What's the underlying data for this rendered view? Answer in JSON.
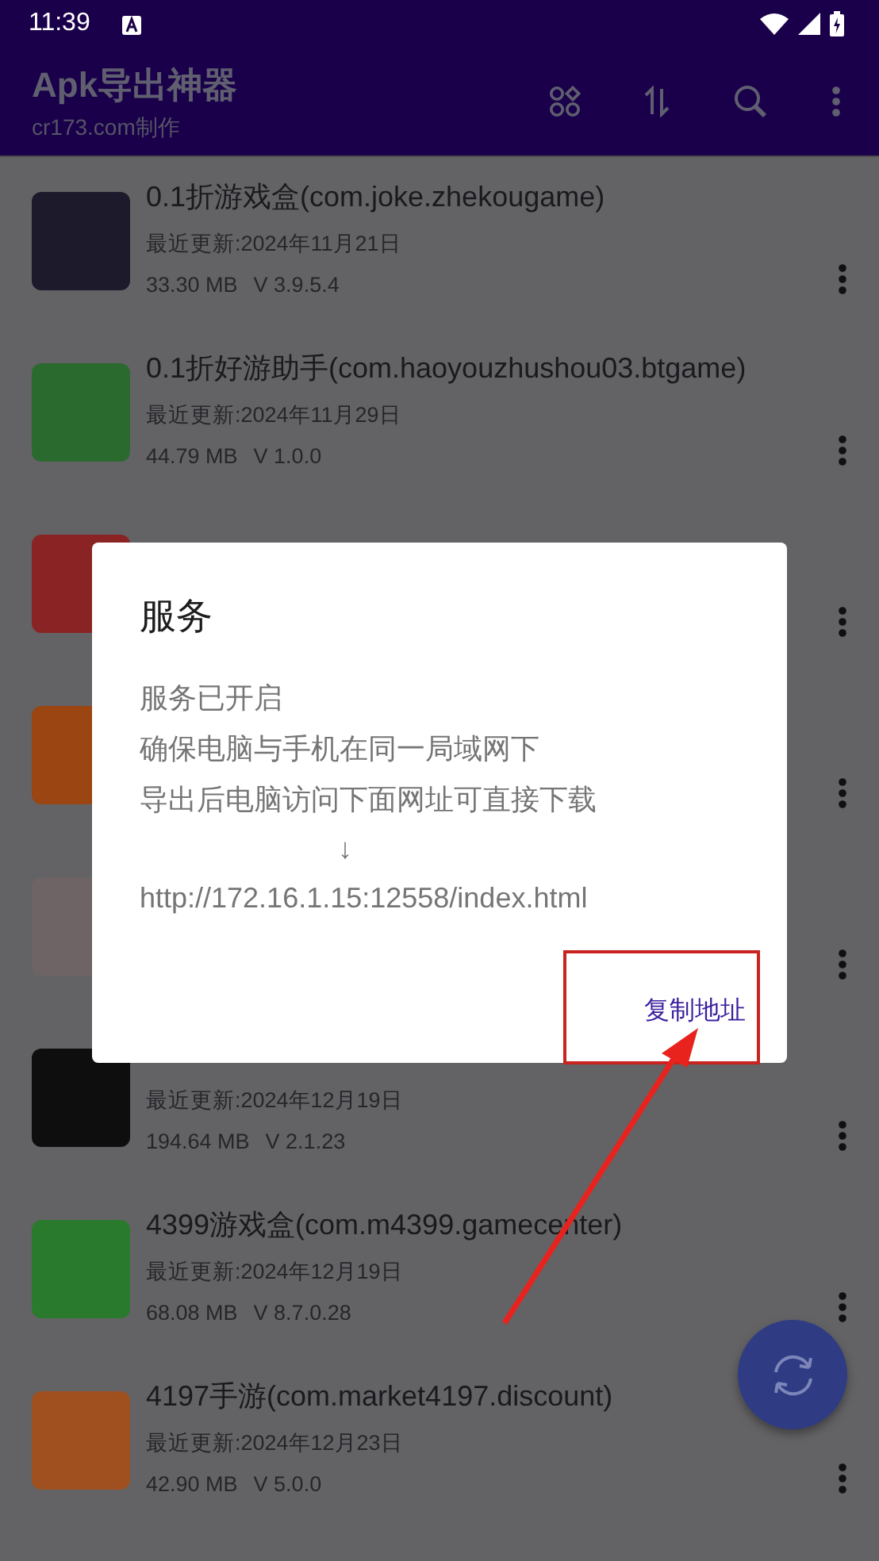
{
  "status_bar": {
    "time": "11:39"
  },
  "app_bar": {
    "title": "Apk导出神器",
    "subtitle": "cr173.com制作"
  },
  "apps": [
    {
      "color": "#1d1a2b",
      "title": "0.1折游戏盒(com.joke.zhekougame)",
      "updated": "最近更新:2024年11月21日",
      "size": "33.30 MB",
      "version": "V 3.9.5.4"
    },
    {
      "color": "#2b6a2e",
      "title": "0.1折好游助手(com.haoyouzhushou03.btgame)",
      "updated": "最近更新:2024年11月29日",
      "size": "44.79 MB",
      "version": "V 1.0.0"
    },
    {
      "color": "#8a2424"
    },
    {
      "color": "#9a4512"
    },
    {
      "color": "#6e6466"
    },
    {
      "color": "#0e0e0e",
      "updated": "最近更新:2024年12月19日",
      "size": "194.64 MB",
      "version": "V 2.1.23"
    },
    {
      "color": "#2a7a2e",
      "title": "4399游戏盒(com.m4399.gamecenter)",
      "updated": "最近更新:2024年12月19日",
      "size": "68.08 MB",
      "version": "V 8.7.0.28"
    },
    {
      "color": "#a0501e",
      "title": "4197手游(com.market4197.discount)",
      "updated": "最近更新:2024年12月23日",
      "size": "42.90 MB",
      "version": "V 5.0.0"
    }
  ],
  "dialog": {
    "title": "服务",
    "lines": [
      "服务已开启",
      "确保电脑与手机在同一局域网下",
      "导出后电脑访问下面网址可直接下载"
    ],
    "pointer": "↓",
    "url": "http://172.16.1.15:12558/index.html",
    "button": "复制地址"
  }
}
